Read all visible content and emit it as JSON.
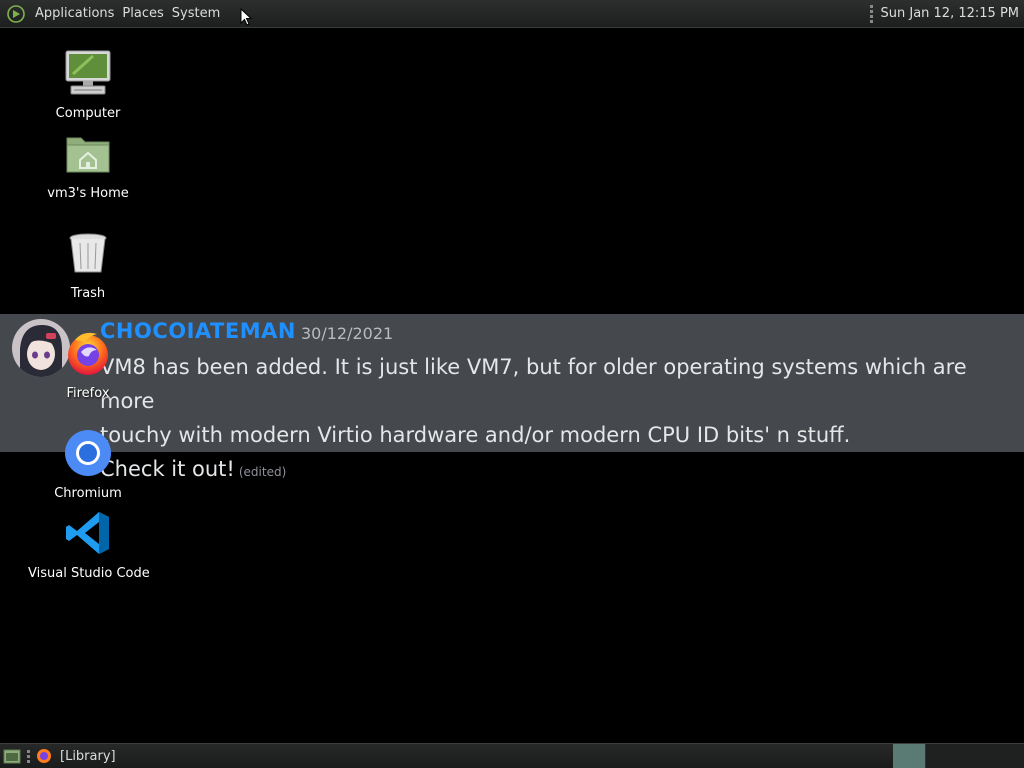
{
  "top_panel": {
    "menus": [
      "Applications",
      "Places",
      "System"
    ],
    "clock": "Sun Jan 12, 12:15 PM"
  },
  "desktop": {
    "icons": [
      {
        "label": "Computer",
        "icon": "computer-icon"
      },
      {
        "label": "vm3's Home",
        "icon": "home-folder-icon"
      },
      {
        "label": "Trash",
        "icon": "trash-icon"
      },
      {
        "label": "Firefox",
        "icon": "firefox-icon"
      },
      {
        "label": "Chromium",
        "icon": "chromium-icon"
      },
      {
        "label": "Visual Studio Code",
        "icon": "vscode-icon"
      }
    ]
  },
  "notification": {
    "username": "CHOCOIATEMAN",
    "timestamp": "30/12/2021",
    "line1": "VM8 has been added. It is just like VM7, but for older operating systems which are more",
    "line2": "touchy with modern Virtio hardware and/or modern CPU ID bits' n stuff.",
    "line3": "Check it out!",
    "edited": "(edited)",
    "username_color": "#1e90ff"
  },
  "bottom_panel": {
    "task_label": "[Library]"
  },
  "colors": {
    "desktop_bg": "#000000",
    "panel_bg": "#2c2f2e",
    "notification_bg": "#484b4f"
  }
}
